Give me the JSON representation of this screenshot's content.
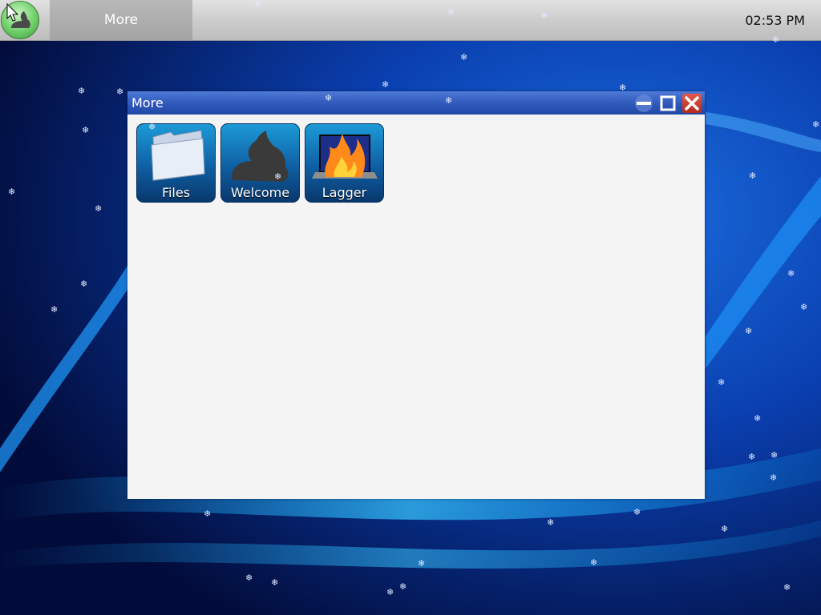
{
  "taskbar": {
    "task_button_label": "More",
    "clock": "02:53 PM"
  },
  "window": {
    "title": "More",
    "launchers": [
      {
        "label": "Files",
        "icon": "folder-icon"
      },
      {
        "label": "Welcome",
        "icon": "welcome-logo-icon"
      },
      {
        "label": "Lagger",
        "icon": "lagger-fire-icon"
      }
    ]
  },
  "colors": {
    "titlebar": "#2c55b8",
    "close_button": "#c83a2a",
    "desktop_background": "#041a5c",
    "launcher_tile": "#0f5fa3"
  }
}
